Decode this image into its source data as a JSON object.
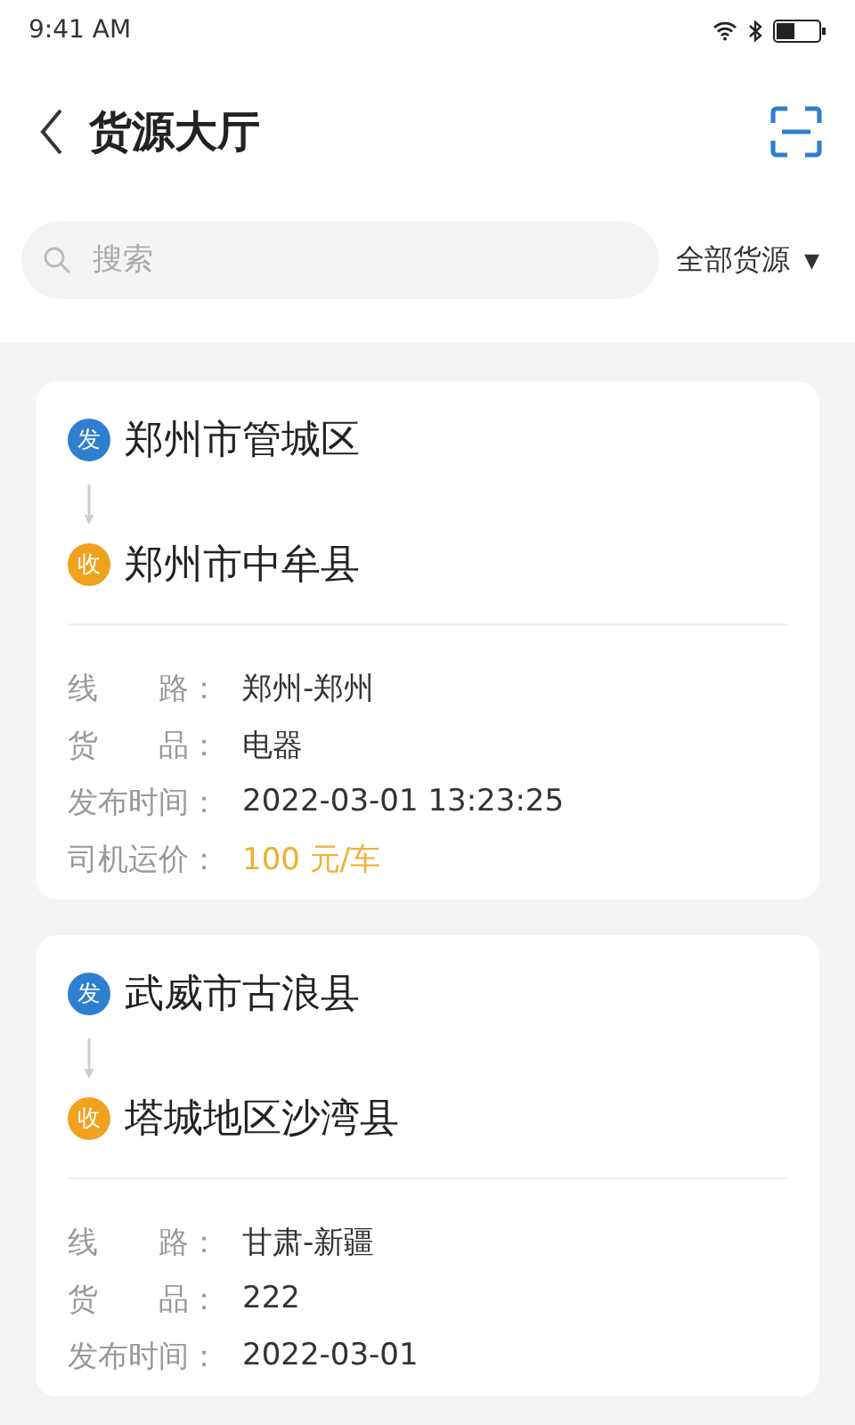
{
  "status_bar": {
    "time": "9:41 AM"
  },
  "header": {
    "title": "货源大厅"
  },
  "search": {
    "placeholder": "搜索"
  },
  "filter": {
    "label": "全部货源",
    "caret": "▼"
  },
  "cards": [
    {
      "from": {
        "badge": "发",
        "place": "郑州市管城区"
      },
      "to": {
        "badge": "收",
        "place": "郑州市中牟县"
      },
      "fields": [
        {
          "kind": "plain",
          "label": "线　　路：",
          "value": "郑州-郑州"
        },
        {
          "kind": "plain",
          "label": "货　　品：",
          "value": "电器"
        },
        {
          "kind": "plain",
          "label": "发布时间：",
          "value": "2022-03-01 13:23:25"
        },
        {
          "kind": "price",
          "label": "司机运价：",
          "value": "100 元/车"
        }
      ]
    },
    {
      "from": {
        "badge": "发",
        "place": "武威市古浪县"
      },
      "to": {
        "badge": "收",
        "place": "塔城地区沙湾县"
      },
      "fields": [
        {
          "kind": "plain",
          "label": "线　　路：",
          "value": "甘肃-新疆"
        },
        {
          "kind": "plain",
          "label": "货　　品：",
          "value": "222"
        },
        {
          "kind": "plain",
          "label": "发布时间：",
          "value": "2022-03-01"
        }
      ]
    }
  ]
}
